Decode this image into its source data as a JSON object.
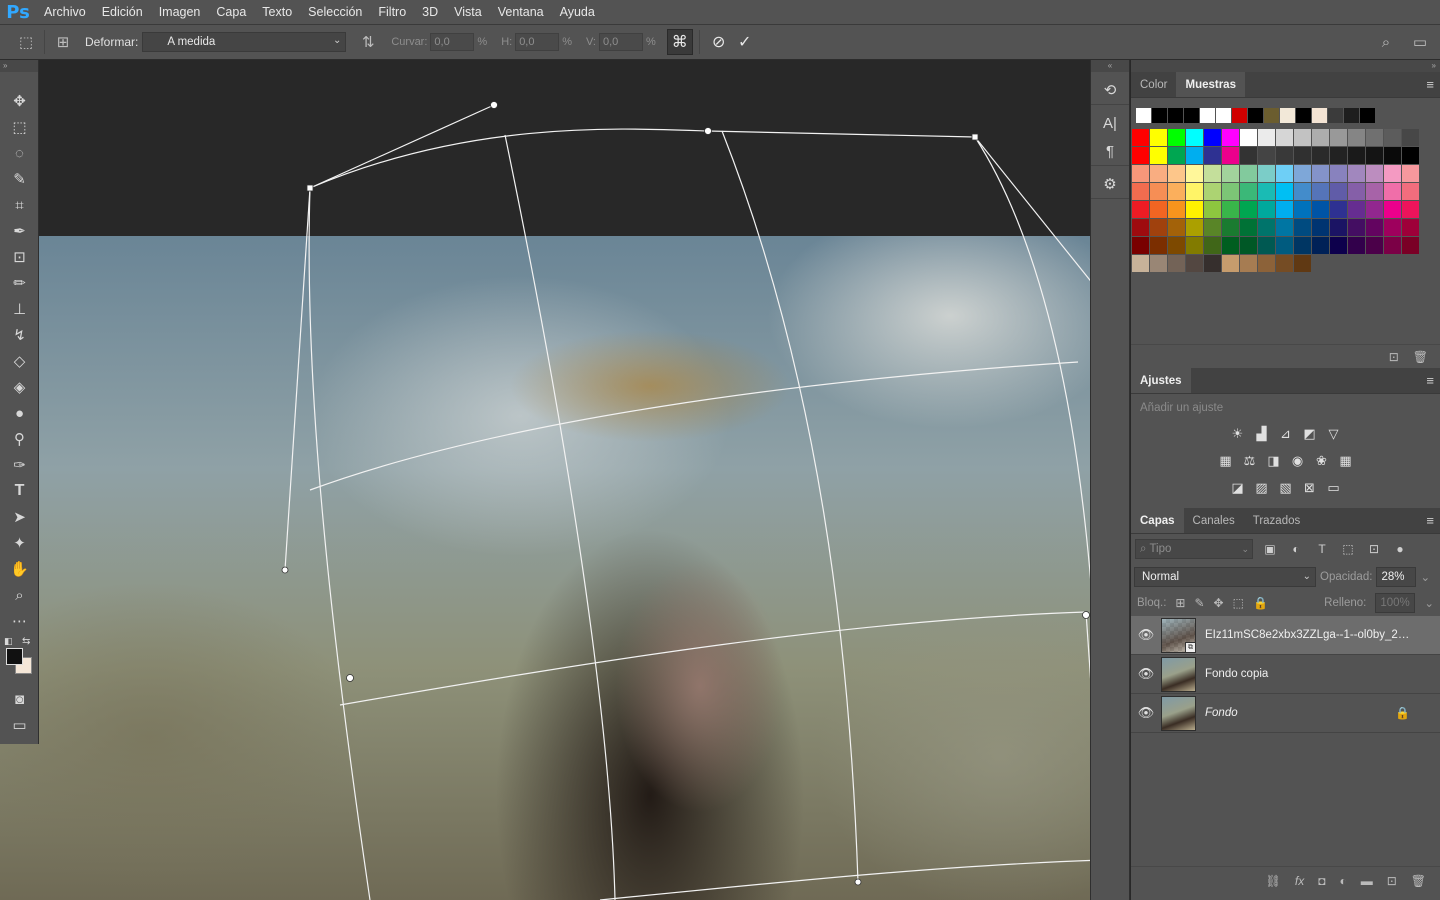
{
  "app": {
    "logo": "Ps",
    "menu": [
      "Archivo",
      "Edición",
      "Imagen",
      "Capa",
      "Texto",
      "Selección",
      "Filtro",
      "3D",
      "Vista",
      "Ventana",
      "Ayuda"
    ]
  },
  "options": {
    "deformar_label": "Deformar:",
    "deformar_value": "A medida",
    "curvar_label": "Curvar:",
    "curvar_value": "0,0",
    "h_label": "H:",
    "h_value": "0,0",
    "v_label": "V:",
    "v_value": "0,0",
    "percent": "%"
  },
  "swatches_panel": {
    "tabs": [
      "Color",
      "Muestras"
    ],
    "active_tab": "Muestras",
    "recent": [
      "#ffffff",
      "#000000",
      "#000000",
      "#000000",
      "#ffffff",
      "#ffffff",
      "#d00000",
      "#000000",
      "#6b5d2f",
      "#f2e8d8",
      "#000000",
      "#f4e4d4",
      "#3b3b3b",
      "#1e1e1e",
      "#000000"
    ],
    "grid": [
      [
        "#ff0000",
        "#ffff00",
        "#00ff00",
        "#00ffff",
        "#0000ff",
        "#ff00ff",
        "#ffffff",
        "#ebebeb",
        "#d6d6d6",
        "#c2c2c2",
        "#adadad",
        "#999999",
        "#858585",
        "#707070",
        "#5c5c5c",
        "#474747"
      ],
      [
        "#ff0000",
        "#ffff00",
        "#00a651",
        "#00aeef",
        "#2e3192",
        "#ec008c",
        "#333333",
        "#444444",
        "#393939",
        "#303030",
        "#2a2a2a",
        "#222222",
        "#1a1a1a",
        "#141414",
        "#0a0a0a",
        "#000000"
      ],
      [
        "#f7977a",
        "#f9ad81",
        "#fdc68a",
        "#fff79a",
        "#c4df9b",
        "#a2d39c",
        "#82ca9d",
        "#7bcdc8",
        "#6ecff6",
        "#7ea7d8",
        "#8493ca",
        "#8882be",
        "#a187be",
        "#bc8dbf",
        "#f49ac2",
        "#f6989d"
      ],
      [
        "#f26c4f",
        "#f68e55",
        "#fbaf5c",
        "#fff467",
        "#acd372",
        "#7cc576",
        "#3bb878",
        "#1abbb4",
        "#00bff3",
        "#438ccb",
        "#5574b9",
        "#605ca8",
        "#855fa8",
        "#a763a8",
        "#f06ea9",
        "#f26d7d"
      ],
      [
        "#ed1c24",
        "#f26522",
        "#f7941d",
        "#fff200",
        "#8dc63f",
        "#39b54a",
        "#00a651",
        "#00a99d",
        "#00aeef",
        "#0072bc",
        "#0054a6",
        "#2e3192",
        "#662d91",
        "#92278f",
        "#ec008c",
        "#ed145b"
      ],
      [
        "#9e0b0f",
        "#a0410d",
        "#a36209",
        "#aba000",
        "#598527",
        "#1a7b30",
        "#007236",
        "#00746b",
        "#0076a3",
        "#004b80",
        "#003471",
        "#1b1464",
        "#440e62",
        "#630460",
        "#9e005d",
        "#9e0039"
      ],
      [
        "#790000",
        "#7b2e00",
        "#7d4900",
        "#827b00",
        "#406618",
        "#005e20",
        "#005826",
        "#005952",
        "#005b7f",
        "#003663",
        "#002157",
        "#0d004c",
        "#32004b",
        "#4b0049",
        "#7b0046",
        "#7a0026"
      ],
      [
        "#c7b299",
        "#998675",
        "#736357",
        "#534741",
        "#362f2d",
        "#c69c6d",
        "#a67c52",
        "#8c6239",
        "#754c24",
        "#603913"
      ]
    ]
  },
  "ajustes": {
    "title": "Ajustes",
    "hint": "Añadir un ajuste"
  },
  "layers_panel": {
    "tabs": [
      "Capas",
      "Canales",
      "Trazados"
    ],
    "active_tab": "Capas",
    "filter_placeholder": "Tipo",
    "blend_mode": "Normal",
    "opacity_label": "Opacidad:",
    "opacity_value": "28%",
    "lock_label": "Bloq.:",
    "fill_label": "Relleno:",
    "fill_value": "100%",
    "layers": [
      {
        "name": "EIz11mSC8e2xbx3ZZLga--1--ol0by_2x-...",
        "selected": true,
        "visible": true
      },
      {
        "name": "Fondo copia",
        "selected": false,
        "visible": true
      },
      {
        "name": "Fondo",
        "selected": false,
        "visible": true,
        "locked": true
      }
    ]
  }
}
